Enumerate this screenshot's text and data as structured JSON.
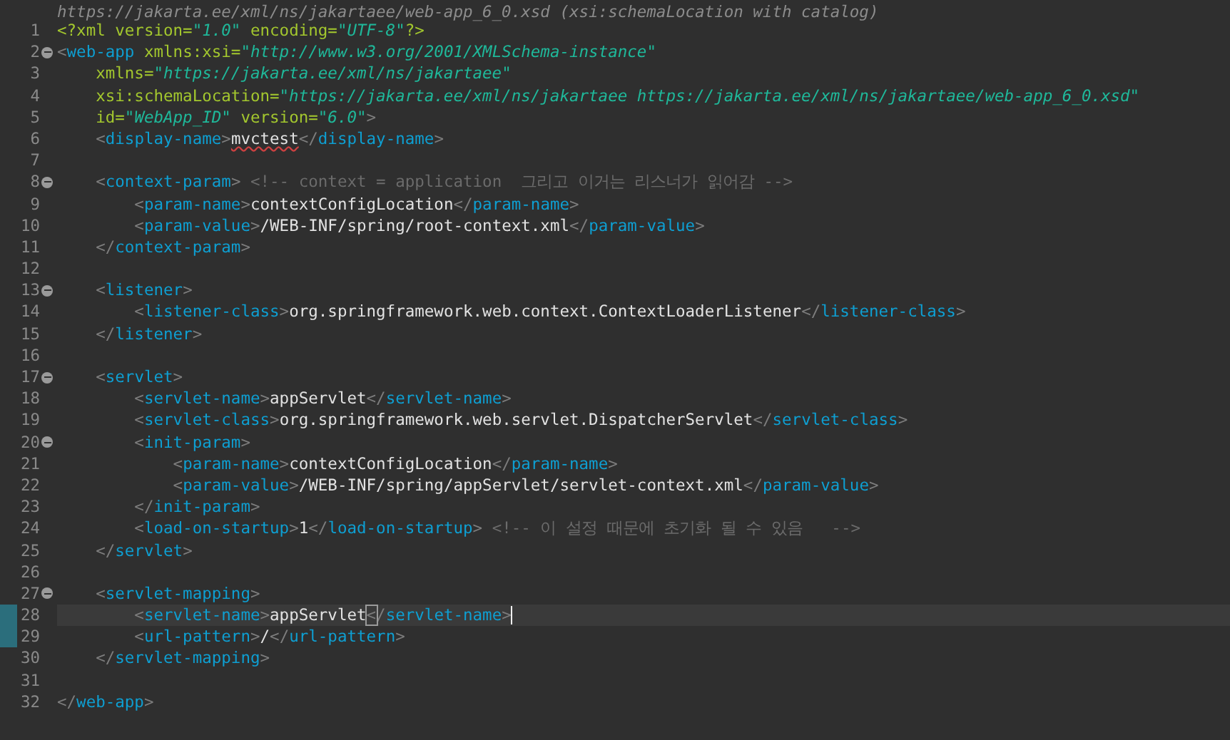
{
  "schema_hint": "https://jakarta.ee/xml/ns/jakartaee/web-app_6_0.xsd (xsi:schemaLocation with catalog)",
  "lines": [
    {
      "number": "1",
      "foldable": false,
      "changed": false,
      "current": false,
      "tokens": [
        {
          "kind": "decl",
          "text": "<?xml version="
        },
        {
          "kind": "value",
          "text": "\"1.0\""
        },
        {
          "kind": "decl",
          "text": " encoding="
        },
        {
          "kind": "value",
          "text": "\"UTF-8\""
        },
        {
          "kind": "decl",
          "text": "?>"
        }
      ]
    },
    {
      "number": "2",
      "foldable": true,
      "changed": false,
      "current": false,
      "tokens": [
        {
          "kind": "bracket",
          "text": "<"
        },
        {
          "kind": "tag",
          "text": "web-app"
        },
        {
          "kind": "attr",
          "text": " xmlns:xsi="
        },
        {
          "kind": "value",
          "text": "\"http://www.w3.org/2001/XMLSchema-instance\""
        }
      ]
    },
    {
      "number": "3",
      "foldable": false,
      "changed": false,
      "current": false,
      "tokens": [
        {
          "kind": "attr",
          "text": "    xmlns="
        },
        {
          "kind": "value",
          "text": "\"https://jakarta.ee/xml/ns/jakartaee\""
        }
      ]
    },
    {
      "number": "4",
      "foldable": false,
      "changed": false,
      "current": false,
      "tokens": [
        {
          "kind": "attr",
          "text": "    xsi:schemaLocation="
        },
        {
          "kind": "value",
          "text": "\"https://jakarta.ee/xml/ns/jakartaee https://jakarta.ee/xml/ns/jakartaee/web-app_6_0.xsd\""
        }
      ]
    },
    {
      "number": "5",
      "foldable": false,
      "changed": false,
      "current": false,
      "tokens": [
        {
          "kind": "attr",
          "text": "    id="
        },
        {
          "kind": "value",
          "text": "\"WebApp_ID\""
        },
        {
          "kind": "attr",
          "text": " version="
        },
        {
          "kind": "value",
          "text": "\"6.0\""
        },
        {
          "kind": "bracket",
          "text": ">"
        }
      ]
    },
    {
      "number": "6",
      "foldable": false,
      "changed": false,
      "current": false,
      "tokens": [
        {
          "kind": "bracket",
          "text": "    <"
        },
        {
          "kind": "tag",
          "text": "display-name"
        },
        {
          "kind": "bracket",
          "text": ">"
        },
        {
          "kind": "misspelled",
          "text": "mvctest"
        },
        {
          "kind": "bracket",
          "text": "</"
        },
        {
          "kind": "tag",
          "text": "display-name"
        },
        {
          "kind": "bracket",
          "text": ">"
        }
      ]
    },
    {
      "number": "7",
      "foldable": false,
      "changed": false,
      "current": false
    },
    {
      "number": "8",
      "foldable": true,
      "changed": false,
      "current": false,
      "tokens": [
        {
          "kind": "bracket",
          "text": "    <"
        },
        {
          "kind": "tag",
          "text": "context-param"
        },
        {
          "kind": "bracket",
          "text": ">"
        },
        {
          "kind": "comment",
          "text": " <!-- context = application  그리고 이거는 리스너가 읽어감 -->"
        }
      ]
    },
    {
      "number": "9",
      "foldable": false,
      "changed": false,
      "current": false,
      "tokens": [
        {
          "kind": "bracket",
          "text": "        <"
        },
        {
          "kind": "tag",
          "text": "param-name"
        },
        {
          "kind": "bracket",
          "text": ">"
        },
        {
          "kind": "text",
          "text": "contextConfigLocation"
        },
        {
          "kind": "bracket",
          "text": "</"
        },
        {
          "kind": "tag",
          "text": "param-name"
        },
        {
          "kind": "bracket",
          "text": ">"
        }
      ]
    },
    {
      "number": "10",
      "foldable": false,
      "changed": false,
      "current": false,
      "tokens": [
        {
          "kind": "bracket",
          "text": "        <"
        },
        {
          "kind": "tag",
          "text": "param-value"
        },
        {
          "kind": "bracket",
          "text": ">"
        },
        {
          "kind": "text",
          "text": "/WEB-INF/spring/root-context.xml"
        },
        {
          "kind": "bracket",
          "text": "</"
        },
        {
          "kind": "tag",
          "text": "param-value"
        },
        {
          "kind": "bracket",
          "text": ">"
        }
      ]
    },
    {
      "number": "11",
      "foldable": false,
      "changed": false,
      "current": false,
      "tokens": [
        {
          "kind": "bracket",
          "text": "    </"
        },
        {
          "kind": "tag",
          "text": "context-param"
        },
        {
          "kind": "bracket",
          "text": ">"
        }
      ]
    },
    {
      "number": "12",
      "foldable": false,
      "changed": false,
      "current": false
    },
    {
      "number": "13",
      "foldable": true,
      "changed": false,
      "current": false,
      "tokens": [
        {
          "kind": "bracket",
          "text": "    <"
        },
        {
          "kind": "tag",
          "text": "listener"
        },
        {
          "kind": "bracket",
          "text": ">"
        }
      ]
    },
    {
      "number": "14",
      "foldable": false,
      "changed": false,
      "current": false,
      "tokens": [
        {
          "kind": "bracket",
          "text": "        <"
        },
        {
          "kind": "tag",
          "text": "listener-class"
        },
        {
          "kind": "bracket",
          "text": ">"
        },
        {
          "kind": "text",
          "text": "org.springframework.web.context.ContextLoaderListener"
        },
        {
          "kind": "bracket",
          "text": "</"
        },
        {
          "kind": "tag",
          "text": "listener-class"
        },
        {
          "kind": "bracket",
          "text": ">"
        }
      ]
    },
    {
      "number": "15",
      "foldable": false,
      "changed": false,
      "current": false,
      "tokens": [
        {
          "kind": "bracket",
          "text": "    </"
        },
        {
          "kind": "tag",
          "text": "listener"
        },
        {
          "kind": "bracket",
          "text": ">"
        }
      ]
    },
    {
      "number": "16",
      "foldable": false,
      "changed": false,
      "current": false
    },
    {
      "number": "17",
      "foldable": true,
      "changed": false,
      "current": false,
      "tokens": [
        {
          "kind": "bracket",
          "text": "    <"
        },
        {
          "kind": "tag",
          "text": "servlet"
        },
        {
          "kind": "bracket",
          "text": ">"
        }
      ]
    },
    {
      "number": "18",
      "foldable": false,
      "changed": false,
      "current": false,
      "tokens": [
        {
          "kind": "bracket",
          "text": "        <"
        },
        {
          "kind": "tag",
          "text": "servlet-name"
        },
        {
          "kind": "bracket",
          "text": ">"
        },
        {
          "kind": "text",
          "text": "appServlet"
        },
        {
          "kind": "bracket",
          "text": "</"
        },
        {
          "kind": "tag",
          "text": "servlet-name"
        },
        {
          "kind": "bracket",
          "text": ">"
        }
      ]
    },
    {
      "number": "19",
      "foldable": false,
      "changed": false,
      "current": false,
      "tokens": [
        {
          "kind": "bracket",
          "text": "        <"
        },
        {
          "kind": "tag",
          "text": "servlet-class"
        },
        {
          "kind": "bracket",
          "text": ">"
        },
        {
          "kind": "text",
          "text": "org.springframework.web.servlet.DispatcherServlet"
        },
        {
          "kind": "bracket",
          "text": "</"
        },
        {
          "kind": "tag",
          "text": "servlet-class"
        },
        {
          "kind": "bracket",
          "text": ">"
        }
      ]
    },
    {
      "number": "20",
      "foldable": true,
      "changed": false,
      "current": false,
      "tokens": [
        {
          "kind": "bracket",
          "text": "        <"
        },
        {
          "kind": "tag",
          "text": "init-param"
        },
        {
          "kind": "bracket",
          "text": ">"
        }
      ]
    },
    {
      "number": "21",
      "foldable": false,
      "changed": false,
      "current": false,
      "tokens": [
        {
          "kind": "bracket",
          "text": "            <"
        },
        {
          "kind": "tag",
          "text": "param-name"
        },
        {
          "kind": "bracket",
          "text": ">"
        },
        {
          "kind": "text",
          "text": "contextConfigLocation"
        },
        {
          "kind": "bracket",
          "text": "</"
        },
        {
          "kind": "tag",
          "text": "param-name"
        },
        {
          "kind": "bracket",
          "text": ">"
        }
      ]
    },
    {
      "number": "22",
      "foldable": false,
      "changed": false,
      "current": false,
      "tokens": [
        {
          "kind": "bracket",
          "text": "            <"
        },
        {
          "kind": "tag",
          "text": "param-value"
        },
        {
          "kind": "bracket",
          "text": ">"
        },
        {
          "kind": "text",
          "text": "/WEB-INF/spring/appServlet/servlet-context.xml"
        },
        {
          "kind": "bracket",
          "text": "</"
        },
        {
          "kind": "tag",
          "text": "param-value"
        },
        {
          "kind": "bracket",
          "text": ">"
        }
      ]
    },
    {
      "number": "23",
      "foldable": false,
      "changed": false,
      "current": false,
      "tokens": [
        {
          "kind": "bracket",
          "text": "        </"
        },
        {
          "kind": "tag",
          "text": "init-param"
        },
        {
          "kind": "bracket",
          "text": ">"
        }
      ]
    },
    {
      "number": "24",
      "foldable": false,
      "changed": false,
      "current": false,
      "tokens": [
        {
          "kind": "bracket",
          "text": "        <"
        },
        {
          "kind": "tag",
          "text": "load-on-startup"
        },
        {
          "kind": "bracket",
          "text": ">"
        },
        {
          "kind": "text",
          "text": "1"
        },
        {
          "kind": "bracket",
          "text": "</"
        },
        {
          "kind": "tag",
          "text": "load-on-startup"
        },
        {
          "kind": "bracket",
          "text": ">"
        },
        {
          "kind": "comment",
          "text": " <!-- 이 설정 때문에 초기화 될 수 있음   -->"
        }
      ]
    },
    {
      "number": "25",
      "foldable": false,
      "changed": false,
      "current": false,
      "tokens": [
        {
          "kind": "bracket",
          "text": "    </"
        },
        {
          "kind": "tag",
          "text": "servlet"
        },
        {
          "kind": "bracket",
          "text": ">"
        }
      ]
    },
    {
      "number": "26",
      "foldable": false,
      "changed": false,
      "current": false
    },
    {
      "number": "27",
      "foldable": true,
      "changed": false,
      "current": false,
      "tokens": [
        {
          "kind": "bracket",
          "text": "    <"
        },
        {
          "kind": "tag",
          "text": "servlet-mapping"
        },
        {
          "kind": "bracket",
          "text": ">"
        }
      ]
    },
    {
      "number": "28",
      "foldable": false,
      "changed": true,
      "current": true,
      "tokens": [
        {
          "kind": "bracket",
          "text": "        <"
        },
        {
          "kind": "tag",
          "text": "servlet-name"
        },
        {
          "kind": "bracket",
          "text": ">"
        },
        {
          "kind": "text",
          "text": "appServlet"
        },
        {
          "kind": "matched_bracket",
          "text": "<"
        },
        {
          "kind": "bracket",
          "text": "/"
        },
        {
          "kind": "tag",
          "text": "servlet-name"
        },
        {
          "kind": "bracket",
          "text": ">"
        }
      ]
    },
    {
      "number": "29",
      "foldable": false,
      "changed": true,
      "current": false,
      "tokens": [
        {
          "kind": "bracket",
          "text": "        <"
        },
        {
          "kind": "tag",
          "text": "url-pattern"
        },
        {
          "kind": "bracket",
          "text": ">"
        },
        {
          "kind": "text",
          "text": "/"
        },
        {
          "kind": "bracket",
          "text": "</"
        },
        {
          "kind": "tag",
          "text": "url-pattern"
        },
        {
          "kind": "bracket",
          "text": ">"
        }
      ]
    },
    {
      "number": "30",
      "foldable": false,
      "changed": false,
      "current": false,
      "tokens": [
        {
          "kind": "bracket",
          "text": "    </"
        },
        {
          "kind": "tag",
          "text": "servlet-mapping"
        },
        {
          "kind": "bracket",
          "text": ">"
        }
      ]
    },
    {
      "number": "31",
      "foldable": false,
      "changed": false,
      "current": false
    },
    {
      "number": "32",
      "foldable": false,
      "changed": false,
      "current": false,
      "tokens": [
        {
          "kind": "bracket",
          "text": "</"
        },
        {
          "kind": "tag",
          "text": "web-app"
        },
        {
          "kind": "bracket",
          "text": ">"
        }
      ]
    }
  ]
}
